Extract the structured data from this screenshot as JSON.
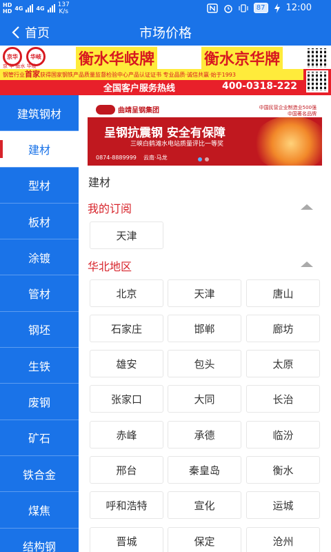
{
  "status_bar": {
    "hd1": "HD",
    "hd2": "HD",
    "net1": "4G",
    "net2": "4G",
    "speed_value": "137",
    "speed_unit": "K/s",
    "battery": "87",
    "time": "12:00"
  },
  "titlebar": {
    "back_label": "首页",
    "title": "市场价格"
  },
  "banner": {
    "logo1": "京华",
    "logo2": "华岐",
    "company": "京 华 衡水 华岐",
    "brand1": "衡水华岐牌",
    "brand2": "衡水京华牌",
    "slogan_prefix": "钢管行业",
    "slogan_highlight": "首家",
    "slogan_rest": "获得国家钢铁产品质量监督检验中心产品认证证书 专业品质·诚信共赢·始于1993",
    "hotline_label": "全国客户服务热线",
    "hotline_number": "400-0318-222"
  },
  "sidebar": {
    "items": [
      {
        "label": "建筑钢材"
      },
      {
        "label": "建材"
      },
      {
        "label": "型材"
      },
      {
        "label": "板材"
      },
      {
        "label": "涂镀"
      },
      {
        "label": "管材"
      },
      {
        "label": "钢坯"
      },
      {
        "label": "生铁"
      },
      {
        "label": "废钢"
      },
      {
        "label": "矿石"
      },
      {
        "label": "铁合金"
      },
      {
        "label": "煤焦"
      },
      {
        "label": "结构钢"
      }
    ],
    "active_index": 1
  },
  "ad": {
    "company": "曲靖呈钢集团",
    "tag1": "中国民营企业制造业500强",
    "tag2": "中国著名品牌",
    "slogan": "呈钢抗震钢   安全有保障",
    "sub": "三峡白鹤滩水电站质量评比一等奖",
    "phone": "0874-8889999",
    "location": "云南·马龙"
  },
  "content": {
    "category_title": "建材",
    "subscription": {
      "title": "我的订阅",
      "cities": [
        "天津"
      ]
    },
    "north_china": {
      "title": "华北地区",
      "cities": [
        "北京",
        "天津",
        "唐山",
        "石家庄",
        "邯郸",
        "廊坊",
        "雄安",
        "包头",
        "太原",
        "张家口",
        "大同",
        "长治",
        "赤峰",
        "承德",
        "临汾",
        "邢台",
        "秦皇岛",
        "衡水",
        "呼和浩特",
        "宣化",
        "运城",
        "晋城",
        "保定",
        "沧州"
      ]
    }
  }
}
